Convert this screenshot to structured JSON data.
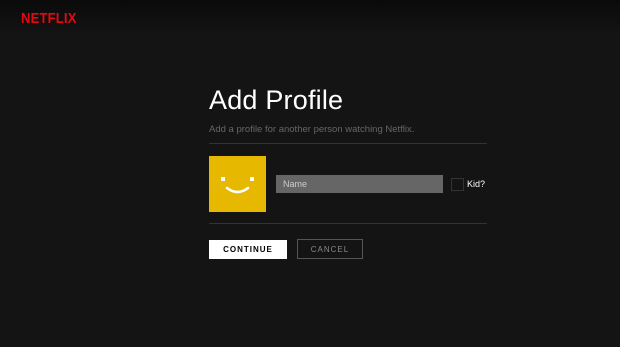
{
  "brand": {
    "logo_text": "NETFLIX",
    "accent_color": "#e50914"
  },
  "dialog": {
    "title": "Add Profile",
    "subtitle": "Add a profile for another person watching Netflix.",
    "avatar": {
      "icon": "smiley-face-icon",
      "color": "#e6b800"
    },
    "name_input": {
      "placeholder": "Name",
      "value": ""
    },
    "kid_checkbox": {
      "label": "Kid?",
      "checked": false
    },
    "buttons": {
      "continue_label": "CONTINUE",
      "cancel_label": "CANCEL"
    }
  }
}
